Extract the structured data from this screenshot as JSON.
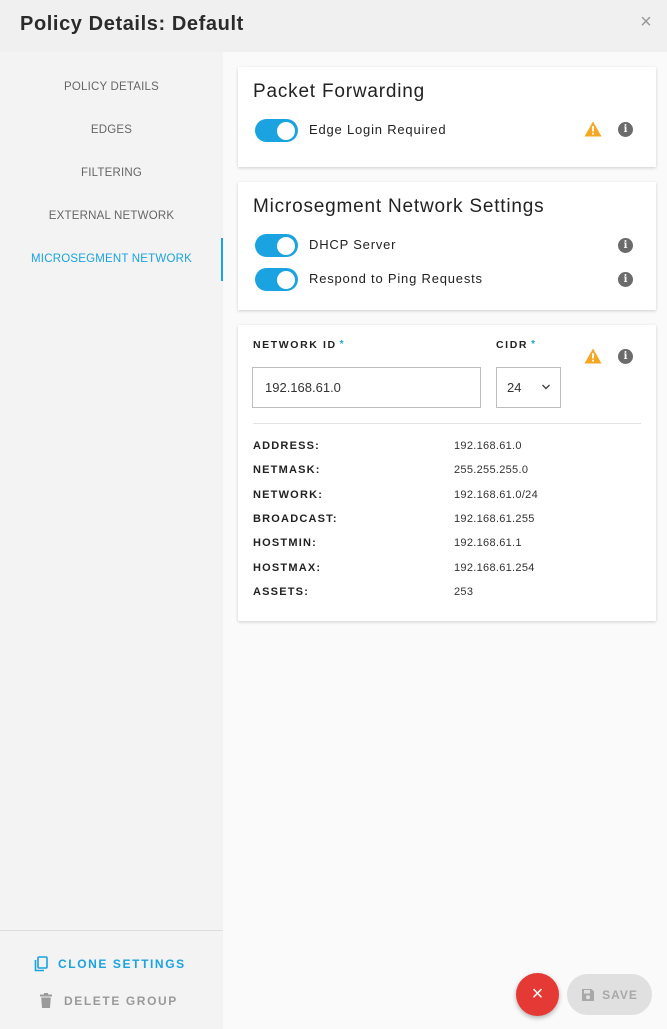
{
  "header": {
    "title": "Policy Details: Default",
    "close_label": "×"
  },
  "sidebar": {
    "items": [
      {
        "label": "POLICY DETAILS"
      },
      {
        "label": "EDGES"
      },
      {
        "label": "FILTERING"
      },
      {
        "label": "EXTERNAL NETWORK"
      },
      {
        "label": "MICROSEGMENT NETWORK",
        "active": true
      }
    ],
    "clone_label": "CLONE SETTINGS",
    "delete_label": "DELETE GROUP"
  },
  "packet_forwarding": {
    "title": "Packet Forwarding",
    "edge_login_label": "Edge Login Required",
    "edge_login_on": true
  },
  "microsegment": {
    "title": "Microsegment Network Settings",
    "dhcp_label": "DHCP Server",
    "dhcp_on": true,
    "ping_label": "Respond to Ping Requests",
    "ping_on": true
  },
  "network": {
    "network_id_label": "NETWORK ID",
    "cidr_label": "CIDR",
    "required_mark": "*",
    "network_id_value": "192.168.61.0",
    "cidr_value": "24",
    "details": [
      {
        "key": "ADDRESS:",
        "value": "192.168.61.0"
      },
      {
        "key": "NETMASK:",
        "value": "255.255.255.0"
      },
      {
        "key": "NETWORK:",
        "value": "192.168.61.0/24"
      },
      {
        "key": "BROADCAST:",
        "value": "192.168.61.255"
      },
      {
        "key": "HOSTMIN:",
        "value": "192.168.61.1"
      },
      {
        "key": "HOSTMAX:",
        "value": "192.168.61.254"
      },
      {
        "key": "ASSETS:",
        "value": "253"
      }
    ]
  },
  "actions": {
    "fab_label": "×",
    "save_label": "SAVE"
  },
  "icons": {
    "info_glyph": "i"
  },
  "colors": {
    "accent": "#1aa3e0",
    "warning": "#f5a623",
    "danger": "#e53935"
  }
}
